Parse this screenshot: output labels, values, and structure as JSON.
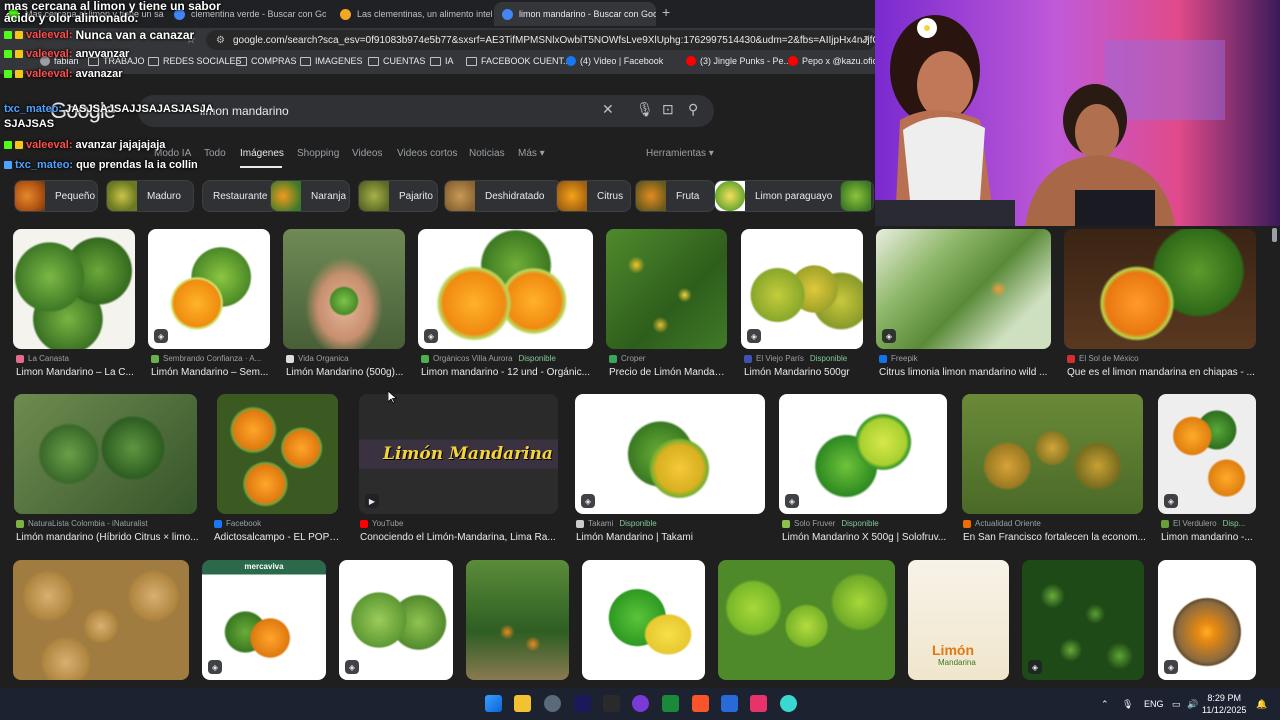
{
  "tabs": [
    {
      "label": "Mas cercana al limon y tiene un sabor ácido y olor alimonado. | Live on Kick"
    },
    {
      "label": "clementina verde - Buscar con Google"
    },
    {
      "label": "Las clementinas, un alimento inteligente"
    },
    {
      "label": "limon mandarino - Buscar con Google",
      "close": "✕"
    }
  ],
  "new_tab": "+",
  "address": "google.com/search?sca_esv=0f91083b974e5b77&sxsrf=AE3TifMPMSNlxOwbiT5NOWfsLve9XlUphg:1762997514430&udm=2&fbs=AIIjpHx4nJjfGojPV...",
  "bookmarks": [
    {
      "label": "fabian"
    },
    {
      "label": "TRABAJO"
    },
    {
      "label": "REDES SOCIALES"
    },
    {
      "label": "COMPRAS"
    },
    {
      "label": "IMAGENES"
    },
    {
      "label": "CUENTAS"
    },
    {
      "label": "IA"
    },
    {
      "label": "FACEBOOK CUENT..."
    },
    {
      "label": "(4) Video | Facebook"
    },
    {
      "label": "(3) Jingle Punks - Pe..."
    },
    {
      "label": "Pepo x @kazu.oficia..."
    }
  ],
  "google": {
    "logo": "Google",
    "query": "limon mandarino",
    "search_tabs": [
      "Modo IA",
      "Todo",
      "Imágenes",
      "Shopping",
      "Videos",
      "Videos cortos",
      "Noticias",
      "Más ▾"
    ],
    "tools": "Herramientas ▾"
  },
  "chips": [
    "Pequeño",
    "Maduro",
    "Restaurante",
    "Naranja",
    "Pajarito",
    "Deshidratado",
    "Citrus",
    "Fruta",
    "Limon paraguayo"
  ],
  "results_row1": [
    {
      "source": "La Canasta",
      "title": "Limon Mandarino – La C..."
    },
    {
      "source": "Sembrando Confianza · A...",
      "title": "Limón Mandarino – Sem..."
    },
    {
      "source": "Vida Organica",
      "title": "Limón Mandarino (500g)..."
    },
    {
      "source": "Orgánicos Villa Aurora",
      "avail": "Disponible",
      "title": "Limon mandarino - 12 und - Orgánic..."
    },
    {
      "source": "Croper",
      "title": "Precio de Limón Mandari..."
    },
    {
      "source": "El Viejo París",
      "avail": "Disponible",
      "title": "Limón Mandarino 500gr"
    },
    {
      "source": "Freepik",
      "title": "Citrus limonia limon mandarino wild ..."
    },
    {
      "source": "El Sol de México",
      "title": "Que es el limon mandarina en chiapas - ..."
    }
  ],
  "results_row2": [
    {
      "source": "NaturaLista Colombia - iNaturalist",
      "title": "Limón mandarino (Híbrido Citrus × limo..."
    },
    {
      "source": "Facebook",
      "title": "Adictosalcampo - EL POPU..."
    },
    {
      "source": "YouTube",
      "title": "Conociendo el Limón-Mandarina, Lima Ra...",
      "overlay": "Limón Mandarina"
    },
    {
      "source": "Takami",
      "avail": "Disponible",
      "title": "Limón Mandarino | Takami"
    },
    {
      "source": "Solo Fruver",
      "avail": "Disponible",
      "title": "Limón Mandarino X 500g | Solofruv..."
    },
    {
      "source": "Actualidad Oriente",
      "title": "En San Francisco fortalecen la econom..."
    },
    {
      "source": "El Verdulero",
      "avail": "Disp...",
      "title": "Limon mandarino -..."
    }
  ],
  "row3_texts": {
    "mercaviva": "mercaviva",
    "infographic": "Limón",
    "infographic_sub": "Mandarina"
  },
  "chat": {
    "top_line1": "mas cercana al limon y tiene un sabor",
    "top_line2": "ácido y olor alimonado.",
    "lines": [
      {
        "user": "valeeval:",
        "msg": "Nunca van a canazar"
      },
      {
        "user": "valeeval:",
        "msg": "anvvanzar"
      },
      {
        "user": "valeeval:",
        "msg": "avanazar"
      },
      {
        "user": "txc_mateo:",
        "msg": "JASJSAJSAJJSAJASJASJA"
      },
      {
        "user": "",
        "msg": "SJAJSAS"
      },
      {
        "user": "valeeval:",
        "msg": "avanzar jajajajaja"
      },
      {
        "user": "txc_mateo:",
        "msg": "que prendas la ia collin"
      }
    ]
  },
  "taskbar": {
    "lang": "ENG",
    "time": "8:29 PM",
    "date": "11/12/2025"
  },
  "colors": {
    "page_bg": "#1f1f1f",
    "chrome_bg": "#35363a",
    "available": "#81c995",
    "chat_user": "#ff4d4d"
  }
}
